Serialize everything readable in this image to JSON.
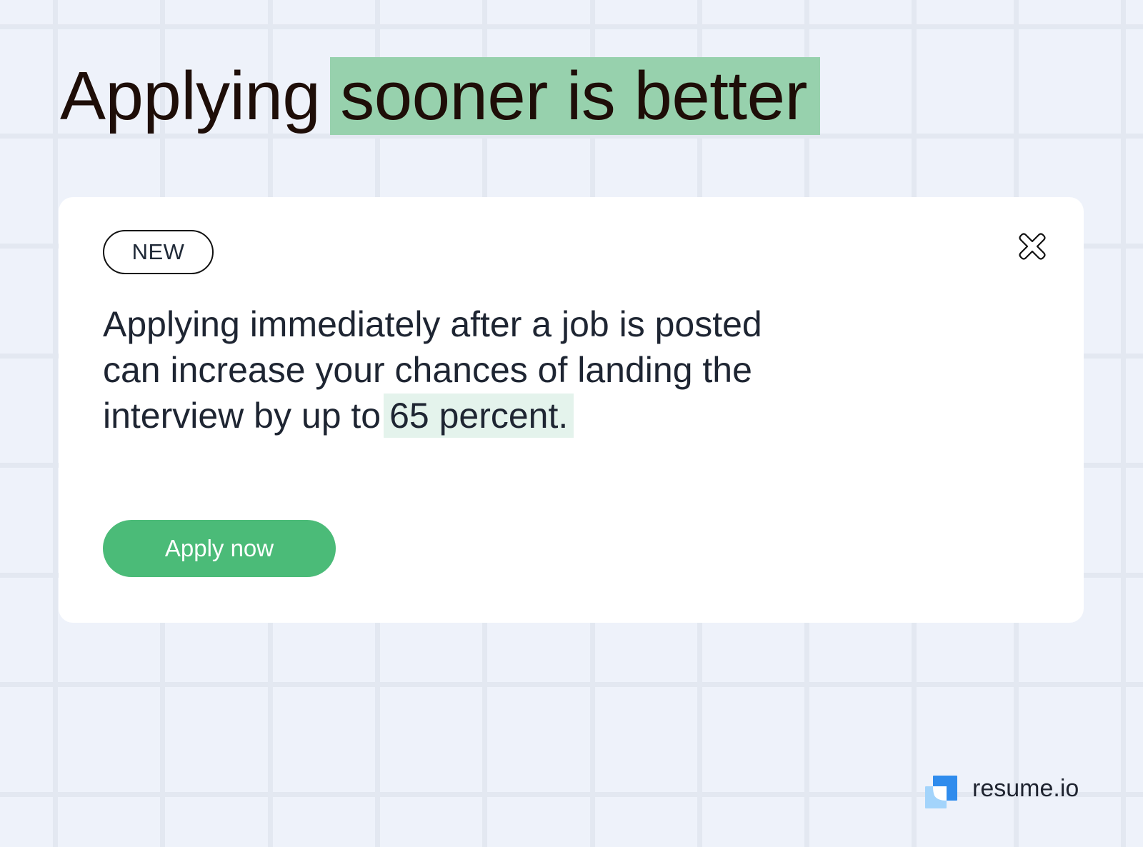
{
  "headline": {
    "plain": "Applying",
    "highlighted": "sooner is better"
  },
  "card": {
    "badge": "NEW",
    "close_icon": "close-x-icon",
    "body_lines": [
      "Applying immediately after a job is posted",
      "can increase your chances of landing the",
      "interview by up to"
    ],
    "body_highlight": "65 percent.",
    "cta_label": "Apply now"
  },
  "brand": {
    "name": "resume.io",
    "logo_icon": "resume-io-logo-icon"
  },
  "colors": {
    "background": "#eef2fa",
    "grid_line": "#e3e8f1",
    "headline_highlight": "#97d1ad",
    "body_highlight": "#e4f3ec",
    "cta": "#4bbb78",
    "logo_primary": "#2f8ced",
    "logo_secondary": "#a3d4fb",
    "text_dark": "#1e2532"
  }
}
